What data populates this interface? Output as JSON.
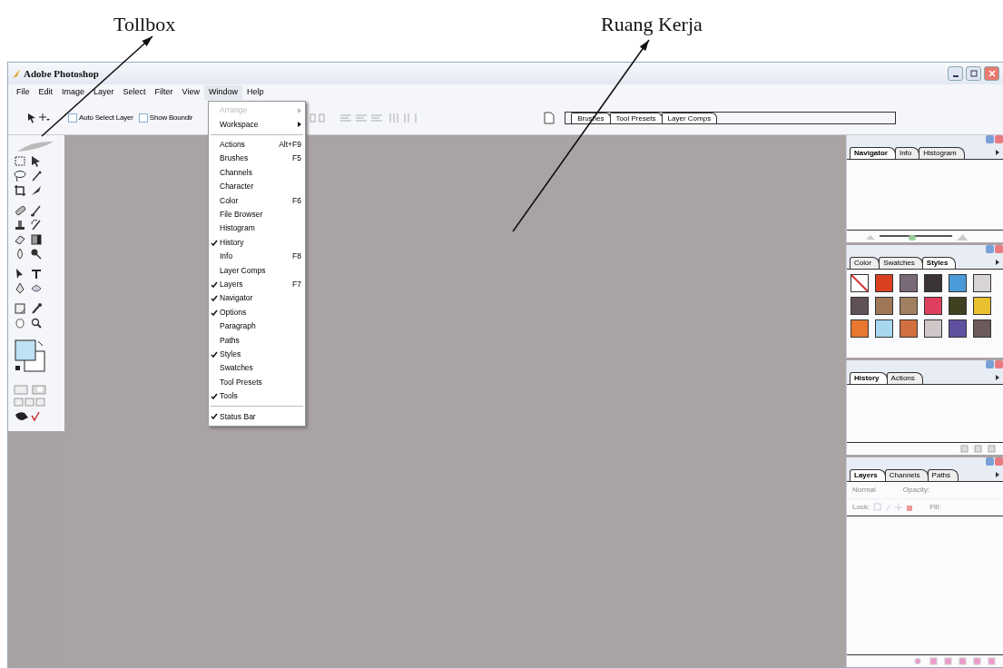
{
  "annotations": [
    {
      "label": "Tollbox"
    },
    {
      "label": "Ruang Kerja"
    }
  ],
  "window": {
    "title": "Adobe Photoshop"
  },
  "menu_bar": [
    {
      "label": "File",
      "selected": false
    },
    {
      "label": "Edit",
      "selected": false
    },
    {
      "label": "Image",
      "selected": false
    },
    {
      "label": "Layer",
      "selected": false
    },
    {
      "label": "Select",
      "selected": false
    },
    {
      "label": "Filter",
      "selected": false
    },
    {
      "label": "View",
      "selected": false
    },
    {
      "label": "Window",
      "selected": true
    },
    {
      "label": "Help",
      "selected": false
    }
  ],
  "window_menu": [
    {
      "kind": "item",
      "label": "Arrange",
      "disabled": true,
      "checked": false,
      "submenu": true
    },
    {
      "kind": "item",
      "label": "Workspace",
      "disabled": false,
      "checked": false,
      "submenu": true
    },
    {
      "kind": "separator"
    },
    {
      "kind": "item",
      "label": "Actions",
      "shortcut": "Alt+F9",
      "disabled": false,
      "checked": false
    },
    {
      "kind": "item",
      "label": "Brushes",
      "shortcut": "F5",
      "disabled": false,
      "checked": false
    },
    {
      "kind": "item",
      "label": "Channels",
      "disabled": false,
      "checked": false
    },
    {
      "kind": "item",
      "label": "Character",
      "disabled": false,
      "checked": false
    },
    {
      "kind": "item",
      "label": "Color",
      "shortcut": "F6",
      "disabled": false,
      "checked": false
    },
    {
      "kind": "item",
      "label": "File Browser",
      "disabled": false,
      "checked": false
    },
    {
      "kind": "item",
      "label": "Histogram",
      "disabled": false,
      "checked": false
    },
    {
      "kind": "item",
      "label": "History",
      "disabled": false,
      "checked": true
    },
    {
      "kind": "item",
      "label": "Info",
      "shortcut": "F8",
      "disabled": false,
      "checked": false
    },
    {
      "kind": "item",
      "label": "Layer Comps",
      "disabled": false,
      "checked": false
    },
    {
      "kind": "item",
      "label": "Layers",
      "shortcut": "F7",
      "disabled": false,
      "checked": true
    },
    {
      "kind": "item",
      "label": "Navigator",
      "disabled": false,
      "checked": true
    },
    {
      "kind": "item",
      "label": "Options",
      "disabled": false,
      "checked": true
    },
    {
      "kind": "item",
      "label": "Paragraph",
      "disabled": false,
      "checked": false
    },
    {
      "kind": "item",
      "label": "Paths",
      "disabled": false,
      "checked": false
    },
    {
      "kind": "item",
      "label": "Styles",
      "disabled": false,
      "checked": true
    },
    {
      "kind": "item",
      "label": "Swatches",
      "disabled": false,
      "checked": false
    },
    {
      "kind": "item",
      "label": "Tool Presets",
      "disabled": false,
      "checked": false
    },
    {
      "kind": "item",
      "label": "Tools",
      "disabled": false,
      "checked": true
    },
    {
      "kind": "separator"
    },
    {
      "kind": "item",
      "label": "Status Bar",
      "disabled": false,
      "checked": true
    }
  ],
  "options_bar": {
    "checkboxes": [
      {
        "label": "Auto Select Layer",
        "checked": false
      },
      {
        "label": "Show Boundir",
        "checked": false
      }
    ]
  },
  "palette_well": {
    "tabs": [
      {
        "label": "Brushes"
      },
      {
        "label": "Tool Presets"
      },
      {
        "label": "Layer Comps"
      }
    ]
  },
  "panels": [
    {
      "kind": "navigator",
      "level": 0.45,
      "tabs": [
        {
          "label": "Navigator",
          "selected": true
        },
        {
          "label": "Info",
          "selected": false
        },
        {
          "label": "Histogram",
          "selected": false
        }
      ]
    },
    {
      "kind": "styles",
      "tabs": [
        {
          "label": "Color",
          "selected": false
        },
        {
          "label": "Swatches",
          "selected": false
        },
        {
          "label": "Styles",
          "selected": true
        }
      ],
      "swatches": [
        {
          "kind": "none"
        },
        {
          "kind": "style",
          "color": "#d84020"
        },
        {
          "kind": "style",
          "color": "#7a6a78"
        },
        {
          "kind": "style",
          "color": "#3a3438"
        },
        {
          "kind": "style",
          "color": "#4a9ad8"
        },
        {
          "kind": "style",
          "color": "#d8d4d4"
        },
        {
          "kind": "style",
          "color": "#605058"
        },
        {
          "kind": "style",
          "color": "#a07858"
        },
        {
          "kind": "style",
          "color": "#a08060"
        },
        {
          "kind": "style",
          "color": "#e04060"
        },
        {
          "kind": "style",
          "color": "#404020"
        },
        {
          "kind": "style",
          "color": "#e8c030"
        },
        {
          "kind": "style",
          "color": "#e87830"
        },
        {
          "kind": "style",
          "color": "#a8d8f0"
        },
        {
          "kind": "style",
          "color": "#d07040"
        },
        {
          "kind": "style",
          "color": "#d0c8c8"
        },
        {
          "kind": "style",
          "color": "#6050a0"
        },
        {
          "kind": "style",
          "color": "#6a5a5a"
        }
      ]
    },
    {
      "kind": "history",
      "tabs": [
        {
          "label": "History",
          "selected": true
        },
        {
          "label": "Actions",
          "selected": false
        }
      ]
    },
    {
      "kind": "layers",
      "tabs": [
        {
          "label": "Layers",
          "selected": true
        },
        {
          "label": "Channels",
          "selected": false
        },
        {
          "label": "Paths",
          "selected": false
        }
      ],
      "blend_mode": {
        "value": "Normal",
        "disabled": true
      },
      "opacity_label": "Opacity:",
      "lock_label": "Lock:",
      "fill_label": "Fill:"
    }
  ]
}
